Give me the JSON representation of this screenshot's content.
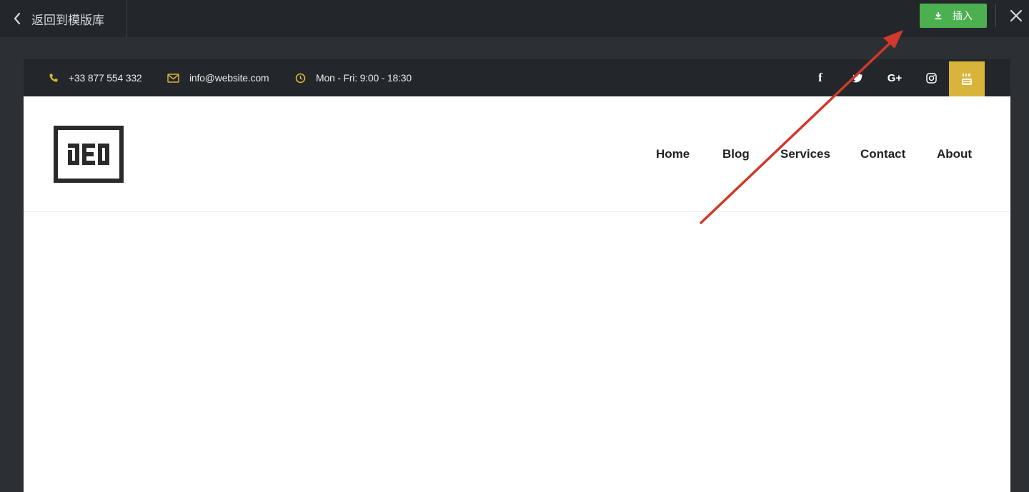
{
  "editor": {
    "back_label": "返回到模版库",
    "insert_label": "插入",
    "accent": "#4caf50"
  },
  "preview": {
    "topbar": {
      "phone": "+33 877 554 332",
      "email": "info@website.com",
      "hours": "Mon - Fri: 9:00 - 18:30",
      "icon_color": "#d9b43a",
      "social": {
        "facebook": "f",
        "google": "G+"
      }
    },
    "logo_text": "DED",
    "nav": {
      "home": "Home",
      "blog": "Blog",
      "services": "Services",
      "contact": "Contact",
      "about": "About"
    }
  },
  "annotation_color": "#d0392b"
}
